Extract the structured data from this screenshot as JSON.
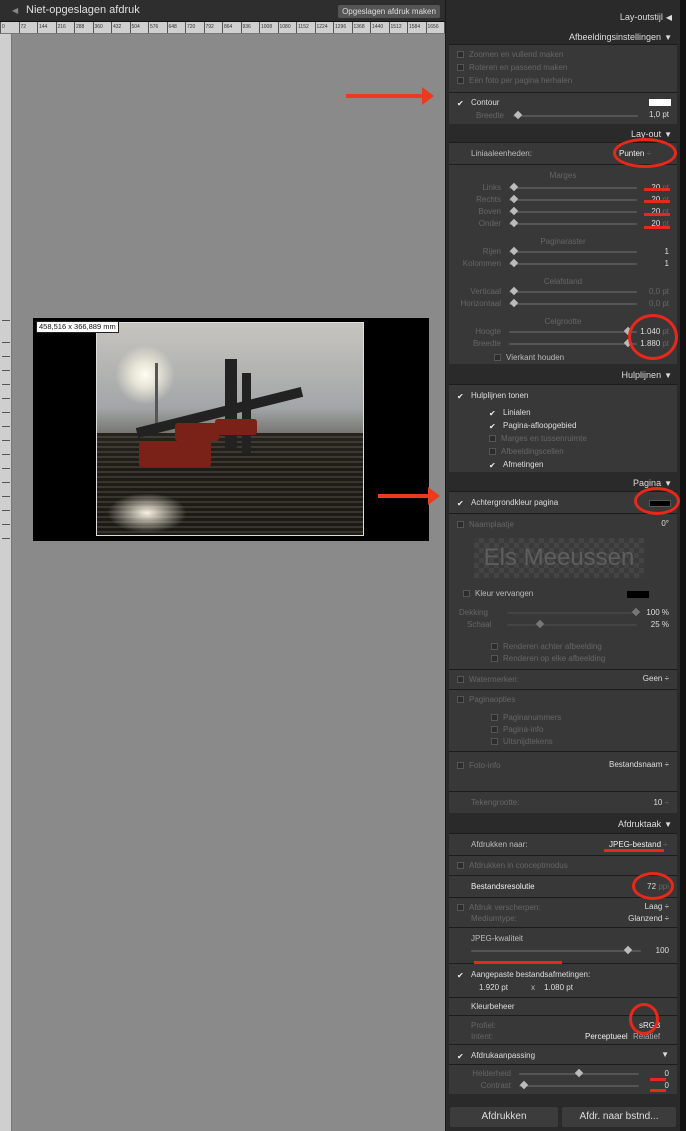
{
  "app": {
    "title": "Niet-opgeslagen afdruk",
    "save_button": "Opgeslagen afdruk maken"
  },
  "ruler": {
    "h_ticks": [
      "0",
      "72",
      "144",
      "216",
      "288",
      "360",
      "432",
      "504",
      "576",
      "648",
      "720",
      "792",
      "864",
      "936",
      "1008",
      "1080",
      "1152",
      "1224",
      "1296",
      "1368",
      "1440",
      "1512",
      "1584",
      "1656",
      "1728",
      "1800",
      "1872"
    ]
  },
  "canvas": {
    "dimensions_label": "458,516 x 366,889 mm"
  },
  "panels": {
    "layout_style": {
      "title": "Lay-outstijl"
    },
    "image_settings": {
      "title": "Afbeeldingsinstellingen",
      "options": [
        "Zoomen en vullend maken",
        "Roteren en passend maken",
        "Eén foto per pagina herhalen"
      ],
      "contour_label": "Contour",
      "width_label": "Breedte",
      "width_value": "1,0 pt"
    },
    "layout": {
      "title": "Lay-out",
      "ruler_units_label": "Liniaaleenheden:",
      "ruler_units_value": "Punten",
      "margins_title": "Marges",
      "margins": [
        {
          "label": "Links",
          "value": "20",
          "unit": "pt"
        },
        {
          "label": "Rechts",
          "value": "20",
          "unit": "pt"
        },
        {
          "label": "Boven",
          "value": "20",
          "unit": "pt"
        },
        {
          "label": "Onder",
          "value": "20",
          "unit": "pt"
        }
      ],
      "grid_title": "Pagina­raster",
      "grid": [
        {
          "label": "Rijen",
          "value": "1"
        },
        {
          "label": "Kolommen",
          "value": "1"
        }
      ],
      "spacing_title": "Celafstand",
      "spacing": [
        {
          "label": "Verticaal",
          "value": "0,0 pt"
        },
        {
          "label": "Horizontaal",
          "value": "0,0 pt"
        }
      ],
      "cell_title": "Celgrootte",
      "cell": [
        {
          "label": "Hoogte",
          "value": "1.040",
          "unit": "pt"
        },
        {
          "label": "Breedte",
          "value": "1.880",
          "unit": "pt"
        }
      ],
      "keep_square": "Vierkant houden"
    },
    "guides": {
      "title": "Hulplijnen",
      "show": "Hulplijnen tonen",
      "items": [
        {
          "label": "Linialen",
          "checked": true
        },
        {
          "label": "Pagina-afloopgebied",
          "checked": true
        },
        {
          "label": "Marges en tussenruimte",
          "checked": false
        },
        {
          "label": "Afbeeldingscellen",
          "checked": false
        },
        {
          "label": "Afmetingen",
          "checked": true
        }
      ]
    },
    "page": {
      "title": "Pagina",
      "bg_color_label": "Achtergrondkleur pagina",
      "nameplate_label": "Naamplaatje",
      "nameplate_angle": "0°",
      "nameplate_text": "Els Meeussen",
      "replace_color": "Kleur vervangen",
      "opacity_label": "Dekking",
      "opacity_value": "100 %",
      "scale_label": "Schaal",
      "scale_value": "25 %",
      "render_behind": "Renderen achter afbeelding",
      "render_each": "Renderen op elke afbeelding",
      "watermark_label": "Watermerken:",
      "watermark_value": "Geen",
      "page_options": "Paginaopties",
      "page_option_items": [
        "Paginanummers",
        "Pagina-info",
        "Uitsnijdtekens"
      ],
      "photo_info_label": "Foto-info",
      "photo_info_value": "Bestandsnaam",
      "font_size_label": "Tekengrootte:",
      "font_size_value": "10"
    },
    "print_job": {
      "title": "Afdruktaak",
      "print_to_label": "Afdrukken naar:",
      "print_to_value": "JPEG-bestand",
      "draft_mode": "Afdrukken in conceptmodus",
      "resolution_label": "Bestandsresolutie",
      "resolution_value": "72",
      "resolution_unit": "ppi",
      "sharpen_label": "Afdruk verscherpen:",
      "sharpen_value": "Laag",
      "media_label": "Mediumtype:",
      "media_value": "Glanzend",
      "jpeg_quality_label": "JPEG-kwaliteit",
      "jpeg_quality_value": "100",
      "custom_size_label": "Aangepaste bestandsafmetingen:",
      "custom_w": "1.920 pt",
      "custom_x": "x",
      "custom_h": "1.080 pt",
      "color_mgmt": "Kleurbeheer",
      "profile_label": "Profiel:",
      "profile_value": "sRGB",
      "intent_label": "Intent:",
      "intent_perceptual": "Perceptueel",
      "intent_relative": "Relatief",
      "adjust_label": "Afdrukaanpassing",
      "brightness_label": "Helderheid",
      "brightness_value": "0",
      "contrast_label": "Contrast",
      "contrast_value": "0"
    }
  },
  "buttons": {
    "print": "Afdrukken",
    "print_to_file": "Afdr. naar bstnd..."
  },
  "colors": {
    "accent_red": "#e8281a",
    "panel_bg": "#383838",
    "canvas_bg": "#8a8a8a"
  }
}
